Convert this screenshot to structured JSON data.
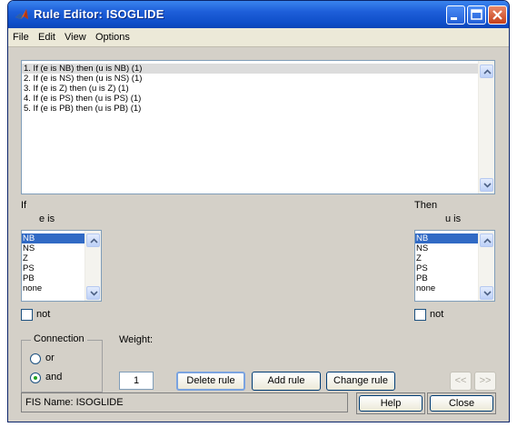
{
  "window": {
    "title": "Rule Editor: ISOGLIDE",
    "icon": "matlab-logo-icon"
  },
  "menu": [
    "File",
    "Edit",
    "View",
    "Options"
  ],
  "rules": [
    "1. If (e is NB) then (u is NB) (1)",
    "2. If (e is NS) then (u is NS) (1)",
    "3. If (e is Z) then (u is Z) (1)",
    "4. If (e is PS) then (u is PS) (1)",
    "5. If (e is PB) then (u is PB) (1)"
  ],
  "selected_rule_index": 0,
  "if_panel": {
    "heading": "If",
    "variable_label": "e is",
    "options": [
      "NB",
      "NS",
      "Z",
      "PS",
      "PB",
      "none"
    ],
    "selected": "NB",
    "not_label": "not",
    "not_checked": false
  },
  "then_panel": {
    "heading": "Then",
    "variable_label": "u is",
    "options": [
      "NB",
      "NS",
      "Z",
      "PS",
      "PB",
      "none"
    ],
    "selected": "NB",
    "not_label": "not",
    "not_checked": false
  },
  "connection": {
    "title": "Connection",
    "options": [
      "or",
      "and"
    ],
    "selected": "and"
  },
  "weight": {
    "label": "Weight:",
    "value": "1"
  },
  "buttons": {
    "delete": "Delete rule",
    "add": "Add rule",
    "change": "Change rule",
    "prev": "<<",
    "next": ">>",
    "help": "Help",
    "close": "Close"
  },
  "status": "FIS Name: ISOGLIDE",
  "colors": {
    "titlebar": "#0f4fc9",
    "selection": "#316ac5",
    "panel": "#d4d0c8"
  }
}
